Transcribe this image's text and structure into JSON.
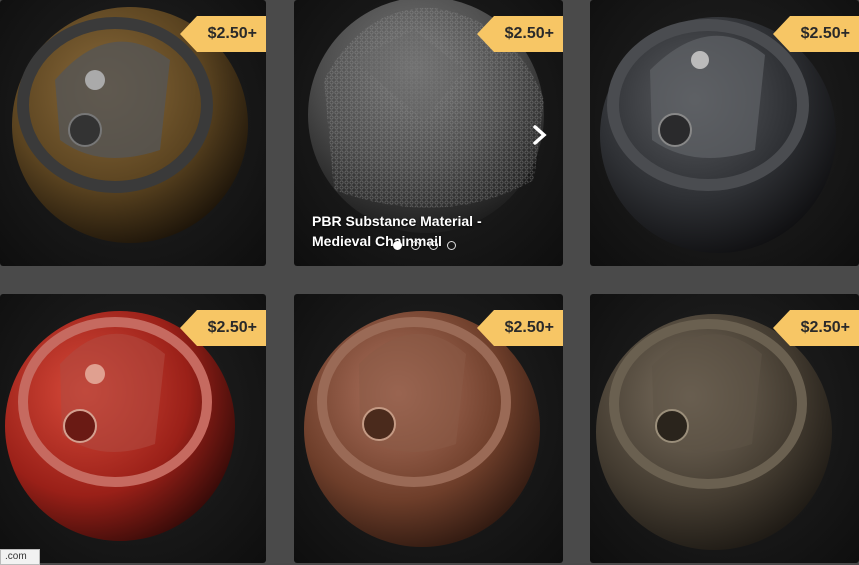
{
  "colors": {
    "price_tag": "#f7c665",
    "page_background": "#4a4a4a"
  },
  "products": [
    {
      "price": "$2.50+",
      "material": "gold-brown metal"
    },
    {
      "price": "$2.50+",
      "material": "chainmail cloth"
    },
    {
      "price": "$2.50+",
      "material": "dark steel"
    },
    {
      "price": "$2.50+",
      "material": "red paint metal"
    },
    {
      "price": "$2.50+",
      "material": "copper wood"
    },
    {
      "price": "$2.50+",
      "material": "dark bronze"
    }
  ],
  "carousel": {
    "caption": "PBR Substance Material - Medieval Chainmail",
    "slide_count": 4,
    "active_slide": 1,
    "next_icon": "chevron-right-icon"
  },
  "status_bar": {
    "text": ".com"
  }
}
